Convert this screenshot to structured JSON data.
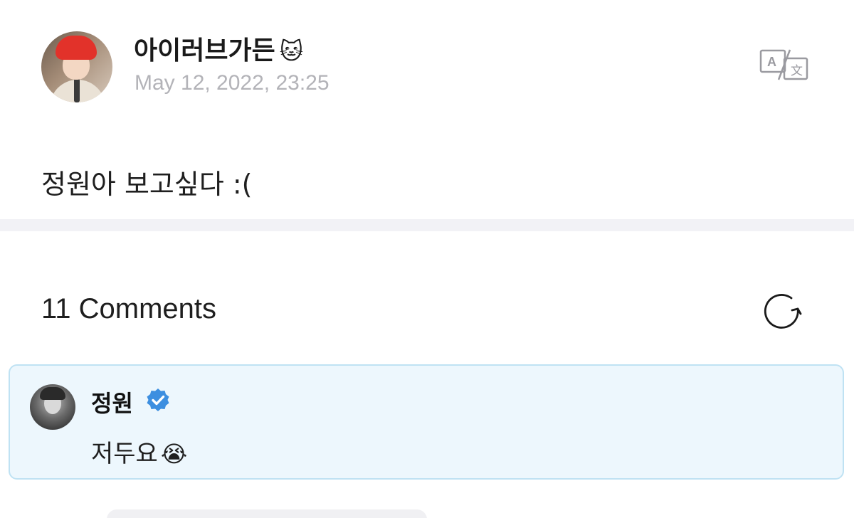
{
  "post": {
    "author": "아이러브가든",
    "author_emoji": "🐱",
    "date": "May 12, 2022, 23:25",
    "text": "정원아 보고싶다 :(",
    "translate_icon": "translate-icon"
  },
  "comments": {
    "count_label": "11 Comments",
    "refresh_icon": "refresh-icon",
    "items": [
      {
        "author": "정원",
        "verified": true,
        "text": "저두요",
        "emoji": "😭"
      }
    ]
  },
  "colors": {
    "accent_verified": "#3d8fe0",
    "highlight_bg": "#edf7fd",
    "highlight_border": "#bfe2f3",
    "muted_text": "#b3b3b8"
  }
}
